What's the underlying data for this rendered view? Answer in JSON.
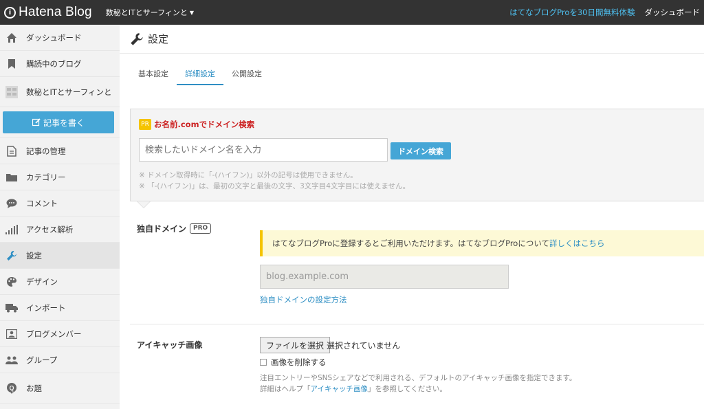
{
  "topbar": {
    "logo_text": "Hatena Blog",
    "blog_name": "数秘とITとサーフィンと",
    "pro_trial": "はてなブログProを30日間無料体験",
    "dashboard": "ダッシュボード"
  },
  "sidebar": {
    "items": [
      {
        "label": "ダッシュボード",
        "icon": "home-icon"
      },
      {
        "label": "購読中のブログ",
        "icon": "bookmark-icon"
      },
      {
        "label": "数秘とITとサーフィンと",
        "icon": "blog-thumb-icon"
      },
      {
        "label": "記事の管理",
        "icon": "document-icon"
      },
      {
        "label": "カテゴリー",
        "icon": "folder-icon"
      },
      {
        "label": "コメント",
        "icon": "comment-icon"
      },
      {
        "label": "アクセス解析",
        "icon": "bar-chart-icon"
      },
      {
        "label": "設定",
        "icon": "wrench-icon"
      },
      {
        "label": "デザイン",
        "icon": "palette-icon"
      },
      {
        "label": "インポート",
        "icon": "truck-icon"
      },
      {
        "label": "ブログメンバー",
        "icon": "member-icon"
      },
      {
        "label": "グループ",
        "icon": "group-icon"
      },
      {
        "label": "お題",
        "icon": "topic-icon"
      }
    ],
    "write_button": "記事を書く"
  },
  "main": {
    "title": "設定",
    "tabs": [
      {
        "label": "基本設定",
        "active": false
      },
      {
        "label": "詳細設定",
        "active": true
      },
      {
        "label": "公開設定",
        "active": false
      }
    ],
    "pr": {
      "badge": "PR",
      "title": "お名前.comでドメイン検索",
      "input_placeholder": "検索したいドメイン名を入力",
      "button": "ドメイン検索",
      "note1": "※ ドメイン取得時に「-(ハイフン)」以外の記号は使用できません。",
      "note2": "※ 「-(ハイフン)」は、最初の文字と最後の文字、3文字目4文字目には使えません。"
    },
    "custom_domain": {
      "label": "独自ドメイン",
      "pro_tag": "PRO",
      "notice": "はてなブログProに登録するとご利用いただけます。はてなブログProについて",
      "notice_link": "詳しくはこちら",
      "placeholder": "blog.example.com",
      "setup_link": "独自ドメインの設定方法"
    },
    "eyecatch": {
      "label": "アイキャッチ画像",
      "file_button": "ファイルを選択",
      "file_status": "選択されていません",
      "delete_label": "画像を削除する",
      "help1": "注目エントリーやSNSシェアなどで利用される、デフォルトのアイキャッチ画像を指定できます。",
      "help2_pre": "詳細はヘルプ「",
      "help2_link": "アイキャッチ画像",
      "help2_post": "」を参照してください。"
    }
  },
  "colors": {
    "accent": "#45a6d6",
    "link": "#2f8fc4",
    "topbar": "#333333",
    "pr_title": "#cc2222",
    "notice_border": "#f5c400"
  }
}
